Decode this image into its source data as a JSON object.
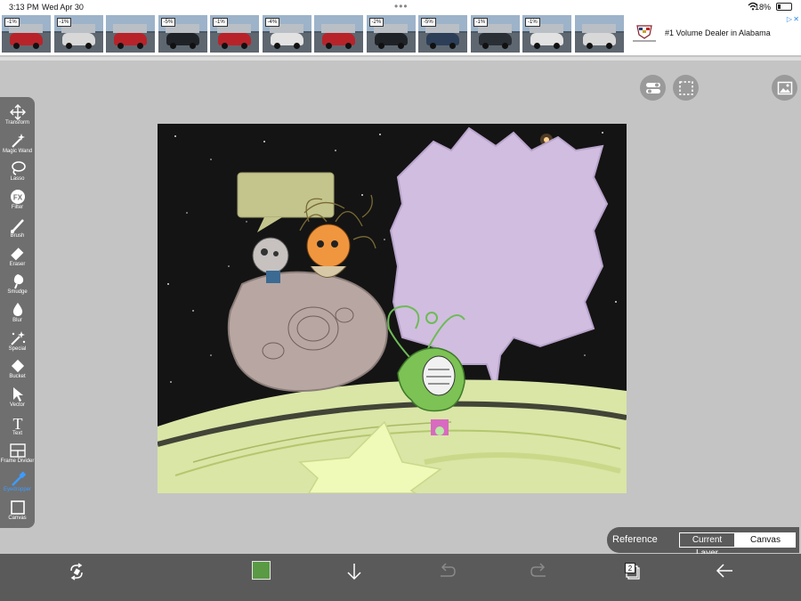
{
  "status_bar": {
    "time": "3:13 PM",
    "date": "Wed Apr 30",
    "battery": "18%"
  },
  "ad": {
    "thumbnails": [
      {
        "tag": "-1%",
        "car_color": "#b8232a"
      },
      {
        "tag": "-1%",
        "car_color": "#d8d8d8"
      },
      {
        "tag": "",
        "car_color": "#b8232a"
      },
      {
        "tag": "-5%",
        "car_color": "#1f2328"
      },
      {
        "tag": "-1%",
        "car_color": "#b8232a"
      },
      {
        "tag": "-4%",
        "car_color": "#e2e2e2"
      },
      {
        "tag": "",
        "car_color": "#b8232a"
      },
      {
        "tag": "-2%",
        "car_color": "#1f2328"
      },
      {
        "tag": "-5%",
        "car_color": "#2c3e58"
      },
      {
        "tag": "-1%",
        "car_color": "#2a2f35"
      },
      {
        "tag": "-1%",
        "car_color": "#e2e2e2"
      },
      {
        "tag": "",
        "car_color": "#d8d8d8"
      }
    ],
    "headline": "#1 Volume Dealer in Alabama"
  },
  "tools": [
    {
      "name": "transform",
      "label": "Transform",
      "icon": "move-arrows-icon"
    },
    {
      "name": "magic-wand",
      "label": "Magic Wand",
      "icon": "magic-wand-icon"
    },
    {
      "name": "lasso",
      "label": "Lasso",
      "icon": "lasso-icon"
    },
    {
      "name": "filter",
      "label": "Filter",
      "icon": "fx-icon"
    },
    {
      "name": "brush",
      "label": "Brush",
      "icon": "brush-icon"
    },
    {
      "name": "eraser",
      "label": "Eraser",
      "icon": "eraser-icon"
    },
    {
      "name": "smudge",
      "label": "Smudge",
      "icon": "smudge-icon"
    },
    {
      "name": "blur",
      "label": "Blur",
      "icon": "drop-icon"
    },
    {
      "name": "special",
      "label": "Special",
      "icon": "sparkle-icon"
    },
    {
      "name": "bucket",
      "label": "Bucket",
      "icon": "bucket-icon"
    },
    {
      "name": "vector",
      "label": "Vector",
      "icon": "cursor-icon"
    },
    {
      "name": "text",
      "label": "Text",
      "icon": "text-icon"
    },
    {
      "name": "frame-divider",
      "label": "Frame Divider",
      "icon": "frame-divider-icon"
    },
    {
      "name": "eyedropper",
      "label": "Eyedropper",
      "icon": "eyedropper-icon",
      "active": true
    },
    {
      "name": "canvas",
      "label": "Canvas",
      "icon": "canvas-icon"
    }
  ],
  "reference": {
    "label": "Reference",
    "current_layer": "Current Layer",
    "canvas": "Canvas",
    "selected": "Canvas"
  },
  "bottom_bar": {
    "color": "#5a9a44",
    "layer_count": "2"
  },
  "colors": {
    "accent": "#3d9cff",
    "toolbar": "#6f6f6f",
    "bottom_bar": "#5a5a5a"
  }
}
